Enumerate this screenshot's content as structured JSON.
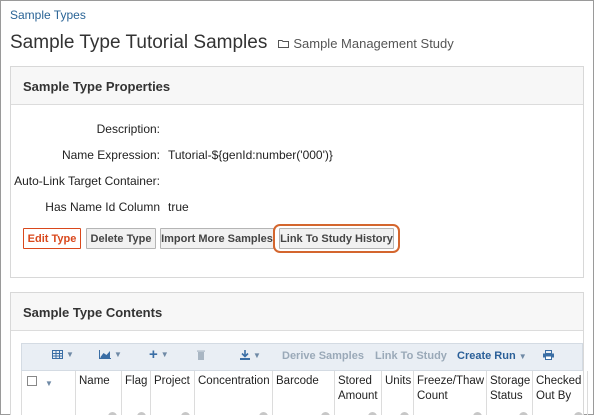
{
  "breadcrumb": "Sample Types",
  "page_title": "Sample Type Tutorial Samples",
  "folder_name": "Sample Management Study",
  "properties_panel": {
    "heading": "Sample Type Properties",
    "rows": [
      {
        "label": "Description:",
        "value": ""
      },
      {
        "label": "Name Expression:",
        "value": "Tutorial-${genId:number('000')}"
      },
      {
        "label": "Auto-Link Target Container:",
        "value": ""
      },
      {
        "label": "Has Name Id Column",
        "value": "true"
      }
    ],
    "buttons": {
      "edit": "Edit Type",
      "delete": "Delete Type",
      "import": "Import More Samples",
      "link": "Link To Study History"
    }
  },
  "contents_panel": {
    "heading": "Sample Type Contents",
    "toolbar": {
      "derive": "Derive Samples",
      "link": "Link To Study",
      "create_run": "Create Run"
    },
    "columns": [
      "Name",
      "Flag",
      "Project",
      "Concentration",
      "Barcode",
      "Stored Amount",
      "Units",
      "Freeze/Thaw Count",
      "Storage Status",
      "Checked Out By"
    ]
  },
  "colors": {
    "link": "#2a6496",
    "accent": "#d9481c",
    "highlight": "#d4662e",
    "toolbar_bg": "#e9eef4"
  }
}
